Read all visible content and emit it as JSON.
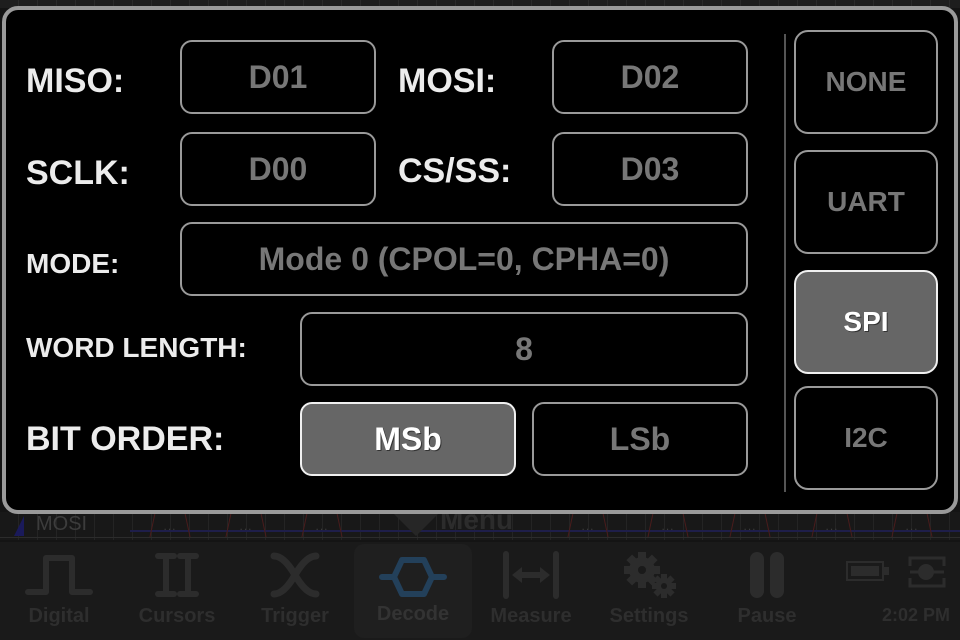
{
  "panel": {
    "miso": {
      "label": "MISO:",
      "value": "D01"
    },
    "mosi": {
      "label": "MOSI:",
      "value": "D02"
    },
    "sclk": {
      "label": "SCLK:",
      "value": "D00"
    },
    "cs": {
      "label": "CS/SS:",
      "value": "D03"
    },
    "mode": {
      "label": "MODE:",
      "value": "Mode 0 (CPOL=0, CPHA=0)"
    },
    "word_length": {
      "label": "WORD LENGTH:",
      "value": "8"
    },
    "bit_order": {
      "label": "BIT ORDER:",
      "options": [
        "MSb",
        "LSb"
      ],
      "selected": "MSb"
    },
    "protocols": {
      "options": [
        "NONE",
        "UART",
        "SPI",
        "I2C"
      ],
      "selected": "SPI"
    }
  },
  "trace": {
    "channel_label": "MOSI",
    "segment_text": "...",
    "menu_label": "Menu"
  },
  "toolbar": {
    "items": [
      {
        "label": "Digital",
        "icon": "square-wave-icon"
      },
      {
        "label": "Cursors",
        "icon": "cursors-icon"
      },
      {
        "label": "Trigger",
        "icon": "trigger-icon"
      },
      {
        "label": "Decode",
        "icon": "decode-icon",
        "active": true
      },
      {
        "label": "Measure",
        "icon": "measure-icon"
      },
      {
        "label": "Settings",
        "icon": "gear-icon"
      },
      {
        "label": "Pause",
        "icon": "pause-icon"
      }
    ],
    "time": "2:02 PM"
  },
  "colors": {
    "selected_bg": "#666666",
    "border": "#9a9a9a",
    "decode_accent": "#2a4a66"
  }
}
